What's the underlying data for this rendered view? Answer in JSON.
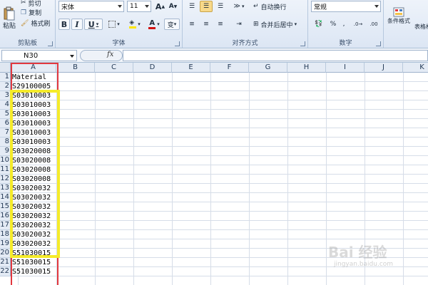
{
  "ribbon": {
    "clipboard": {
      "group_label": "剪贴板",
      "paste_label": "粘贴",
      "cut_label": "剪切",
      "copy_label": "复制",
      "format_painter_label": "格式刷"
    },
    "font": {
      "group_label": "字体",
      "font_name": "宋体",
      "font_size": "11",
      "grow_label": "A",
      "shrink_label": "A",
      "bold_label": "B",
      "italic_label": "I",
      "underline_label": "U",
      "phonetic_label": "变"
    },
    "alignment": {
      "group_label": "对齐方式",
      "wrap_text_label": "自动换行",
      "merge_center_label": "合并后居中"
    },
    "number": {
      "group_label": "数字",
      "format_value": "常规",
      "percent_label": "%",
      "comma_label": ","
    },
    "styles": {
      "conditional_format_label": "条件格式",
      "table_format_label": "表格格"
    },
    "accent_colors": {
      "font_color": "#d01010",
      "fill_color": "#ffe600"
    }
  },
  "formula_bar": {
    "name_box": "N30",
    "fx_label": "fx",
    "formula": ""
  },
  "columns": [
    "A",
    "B",
    "C",
    "D",
    "E",
    "F",
    "G",
    "H",
    "I",
    "J",
    "K"
  ],
  "rows": [
    {
      "num": "1",
      "a": "Material"
    },
    {
      "num": "2",
      "a": "S29100005"
    },
    {
      "num": "3",
      "a": "S03010003"
    },
    {
      "num": "4",
      "a": "S03010003"
    },
    {
      "num": "5",
      "a": "S03010003"
    },
    {
      "num": "6",
      "a": "S03010003"
    },
    {
      "num": "7",
      "a": "S03010003"
    },
    {
      "num": "8",
      "a": "S03010003"
    },
    {
      "num": "9",
      "a": "S03020008"
    },
    {
      "num": "10",
      "a": "S03020008"
    },
    {
      "num": "11",
      "a": "S03020008"
    },
    {
      "num": "12",
      "a": "S03020008"
    },
    {
      "num": "13",
      "a": "S03020032"
    },
    {
      "num": "14",
      "a": "S03020032"
    },
    {
      "num": "15",
      "a": "S03020032"
    },
    {
      "num": "16",
      "a": "S03020032"
    },
    {
      "num": "17",
      "a": "S03020032"
    },
    {
      "num": "18",
      "a": "S03020032"
    },
    {
      "num": "19",
      "a": "S03020032"
    },
    {
      "num": "20",
      "a": "S51030015"
    },
    {
      "num": "21",
      "a": "S51030015"
    },
    {
      "num": "22",
      "a": "S51030015"
    }
  ],
  "highlights": {
    "outer_color": "#e2383f",
    "inner_color": "#f5eb2a"
  },
  "watermark": {
    "text": "Bai 经验",
    "sub": "jingyan.baidu.com"
  }
}
